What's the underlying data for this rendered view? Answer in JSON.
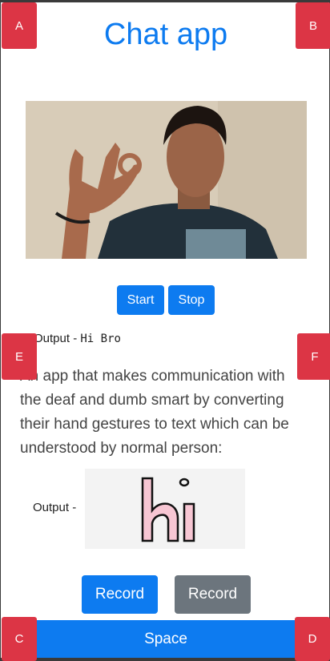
{
  "app": {
    "title": "Chat app"
  },
  "corners": {
    "a": "A",
    "b": "B",
    "c": "C",
    "d": "D",
    "e": "E",
    "f": "F"
  },
  "camera": {
    "start_label": "Start",
    "stop_label": "Stop"
  },
  "output": {
    "label": "Output -",
    "value": "Hi Bro"
  },
  "description": "An app that makes communication with the deaf and dumb smart by converting their hand gestures to text which can be understood by normal person:",
  "output_image": {
    "label": "Output -",
    "image_text": "hi"
  },
  "record": {
    "button1_label": "Record",
    "button2_label": "Record"
  },
  "space_label": "Space",
  "colors": {
    "primary": "#0d7bf0",
    "secondary": "#6c757d",
    "danger": "#dc3545"
  }
}
